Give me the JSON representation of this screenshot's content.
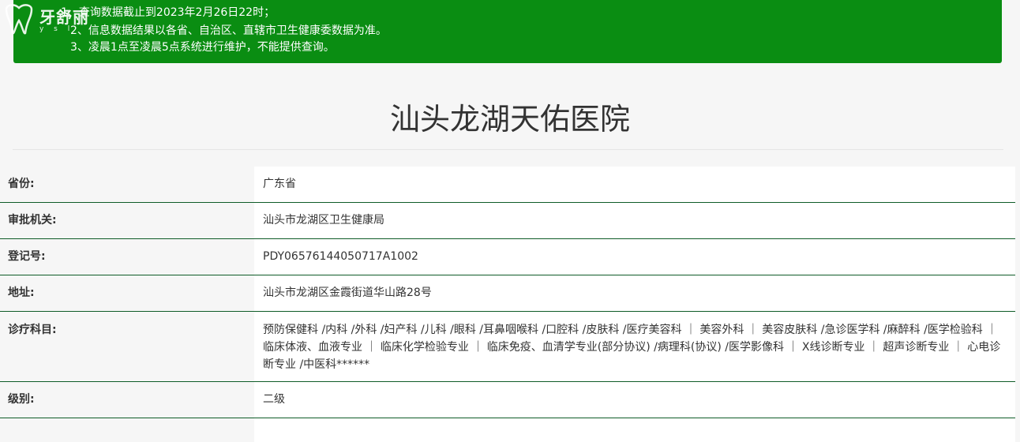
{
  "watermark": {
    "text": "牙舒丽",
    "sub": "y s l"
  },
  "notice": {
    "lines": [
      "1、查询数据截止到2023年2月26日22时；",
      "2、信息数据结果以各省、自治区、直辖市卫生健康委数据为准。",
      "3、凌晨1点至凌晨5点系统进行维护，不能提供查询。"
    ],
    "bg_color": "#0a8d12"
  },
  "hospital": {
    "name": "汕头龙湖天佑医院"
  },
  "fields": [
    {
      "label": "省份:",
      "value": "广东省"
    },
    {
      "label": "审批机关:",
      "value": "汕头市龙湖区卫生健康局"
    },
    {
      "label": "登记号:",
      "value": "PDY06576144050717A1002"
    },
    {
      "label": "地址:",
      "value": "汕头市龙湖区金霞街道华山路28号"
    },
    {
      "label": "诊疗科目:",
      "value": "预防保健科 /内科 /外科 /妇产科 /儿科 /眼科 /耳鼻咽喉科 /口腔科 /皮肤科 /医疗美容科 ｜ 美容外科 ｜ 美容皮肤科 /急诊医学科 /麻醉科 /医学检验科 ｜ 临床体液、血液专业 ｜ 临床化学检验专业 ｜ 临床免疫、血清学专业(部分协议) /病理科(协议) /医学影像科 ｜ X线诊断专业 ｜ 超声诊断专业 ｜ 心电诊断专业 /中医科******"
    },
    {
      "label": "级别:",
      "value": "二级"
    }
  ]
}
